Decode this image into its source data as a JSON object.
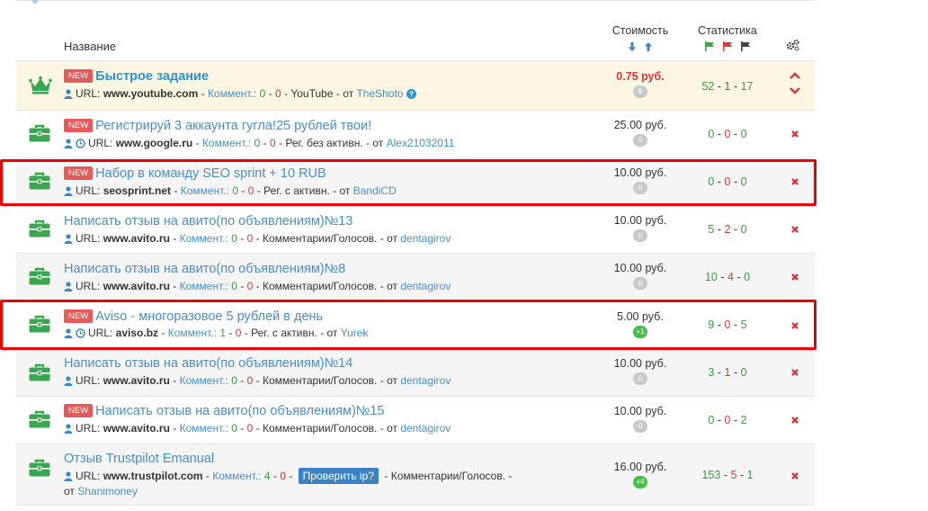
{
  "header": {
    "name_label": "Название",
    "cost_label": "Стоимость",
    "stats_label": "Статистика",
    "settings_icon": "gears-icon"
  },
  "colors": {
    "link": "#4a8ec8",
    "green": "#3a9d3a",
    "red": "#d9383a",
    "briefcase": "#3aa651",
    "new_badge": "#e55a5a",
    "highlight_row": "#fdf6e3",
    "annotation_box": "#ee0000"
  },
  "rows": [
    {
      "icon": "crown-icon",
      "new": "NEW",
      "title": "Быстрое задание",
      "url_label": "URL:",
      "url": "www.youtube.com",
      "comment_label": "Коммент.:",
      "c1": "0",
      "c2": "0",
      "type": "YouTube",
      "from_label": "от",
      "author": "TheShoto",
      "cost": "0.75 руб.",
      "pill": "0",
      "s1": "52",
      "s2": "1",
      "s3": "17"
    },
    {
      "icon": "briefcase-icon",
      "new": "NEW",
      "title": "Регистрируй 3 аккаунта гугла!25 рублей твои!",
      "url_label": "URL:",
      "url": "www.google.ru",
      "comment_label": "Коммент.:",
      "c1": "0",
      "c2": "0",
      "type": "Рег. без активн.",
      "from_label": "от",
      "author": "Alex21032011",
      "cost": "25.00 руб.",
      "pill": "0",
      "s1": "0",
      "s2": "0",
      "s3": "0"
    },
    {
      "icon": "briefcase-icon",
      "new": "NEW",
      "title": "Набор в команду SEO sprint + 10 RUB",
      "url_label": "URL:",
      "url": "seosprint.net",
      "comment_label": "Коммент.:",
      "c1": "0",
      "c2": "0",
      "type": "Рег. с активн.",
      "from_label": "от",
      "author": "BandiCD",
      "cost": "10.00 руб.",
      "pill": "0",
      "s1": "0",
      "s2": "0",
      "s3": "0"
    },
    {
      "icon": "briefcase-icon",
      "title": "Написать отзыв на авито(по объявлениям)№13",
      "url_label": "URL:",
      "url": "www.avito.ru",
      "comment_label": "Коммент.:",
      "c1": "0",
      "c2": "0",
      "type": "Комментарии/Голосов.",
      "from_label": "от",
      "author": "dentagirov",
      "cost": "10.00 руб.",
      "pill": "0",
      "s1": "5",
      "s2": "2",
      "s3": "0"
    },
    {
      "icon": "briefcase-icon",
      "title": "Написать отзыв на авито(по объявлениям)№8",
      "url_label": "URL:",
      "url": "www.avito.ru",
      "comment_label": "Коммент.:",
      "c1": "0",
      "c2": "0",
      "type": "Комментарии/Голосов.",
      "from_label": "от",
      "author": "dentagirov",
      "cost": "10.00 руб.",
      "pill": "0",
      "s1": "10",
      "s2": "4",
      "s3": "0"
    },
    {
      "icon": "briefcase-icon",
      "new": "NEW",
      "title": "Aviso - многоразовое 5 рублей в день",
      "url_label": "URL:",
      "url": "aviso.bz",
      "comment_label": "Коммент.:",
      "c1": "1",
      "c2": "0",
      "type": "Рег. с активн.",
      "from_label": "от",
      "author": "Yurek",
      "cost": "5.00 руб.",
      "pill": "+1",
      "s1": "9",
      "s2": "0",
      "s3": "5"
    },
    {
      "icon": "briefcase-icon",
      "title": "Написать отзыв на авито(по объявлениям)№14",
      "url_label": "URL:",
      "url": "www.avito.ru",
      "comment_label": "Коммент.:",
      "c1": "0",
      "c2": "0",
      "type": "Комментарии/Голосов.",
      "from_label": "от",
      "author": "dentagirov",
      "cost": "10.00 руб.",
      "pill": "0",
      "s1": "3",
      "s2": "1",
      "s3": "0"
    },
    {
      "icon": "briefcase-icon",
      "new": "NEW",
      "title": "Написать отзыв на авито(по объявлениям)№15",
      "url_label": "URL:",
      "url": "www.avito.ru",
      "comment_label": "Коммент.:",
      "c1": "0",
      "c2": "0",
      "type": "Комментарии/Голосов.",
      "from_label": "от",
      "author": "dentagirov",
      "cost": "10.00 руб.",
      "pill": "0",
      "s1": "0",
      "s2": "0",
      "s3": "2"
    },
    {
      "icon": "briefcase-icon",
      "title": "Отзыв Trustpilot Emanual",
      "url_label": "URL:",
      "url": "www.trustpilot.com",
      "comment_label": "Коммент.:",
      "c1": "4",
      "c2": "0",
      "check_ip": "Проверить ip?",
      "type": "Комментарии/Голосов.",
      "from_label": "от",
      "author": "Shanimoney",
      "cost": "16.00 руб.",
      "pill": "+4",
      "s1": "153",
      "s2": "5",
      "s3": "1"
    }
  ]
}
